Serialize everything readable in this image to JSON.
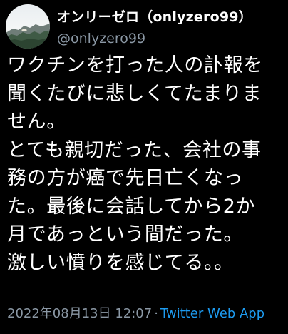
{
  "author": {
    "display_name": "オンリーゼロ（onlyzero99）",
    "handle": "@onlyzero99",
    "avatar_icon": "mountain-landscape-avatar"
  },
  "tweet": {
    "lines": [
      "ワクチンを打った人の訃報を",
      "聞くたびに悲しくてたまりま",
      "せん。",
      "とても親切だった、会社の事",
      "務の方が癌で先日亡くなっ",
      "た。最後に会話してから2か",
      "月であっという間だった。",
      "激しい憤りを感じてる。。"
    ]
  },
  "meta": {
    "timestamp": "2022年08月13日 12:07",
    "separator": "·",
    "source": "Twitter Web App"
  },
  "colors": {
    "background": "#000000",
    "text": "#ffffff",
    "secondary": "#8b98a5",
    "link": "#1d9bf0"
  }
}
